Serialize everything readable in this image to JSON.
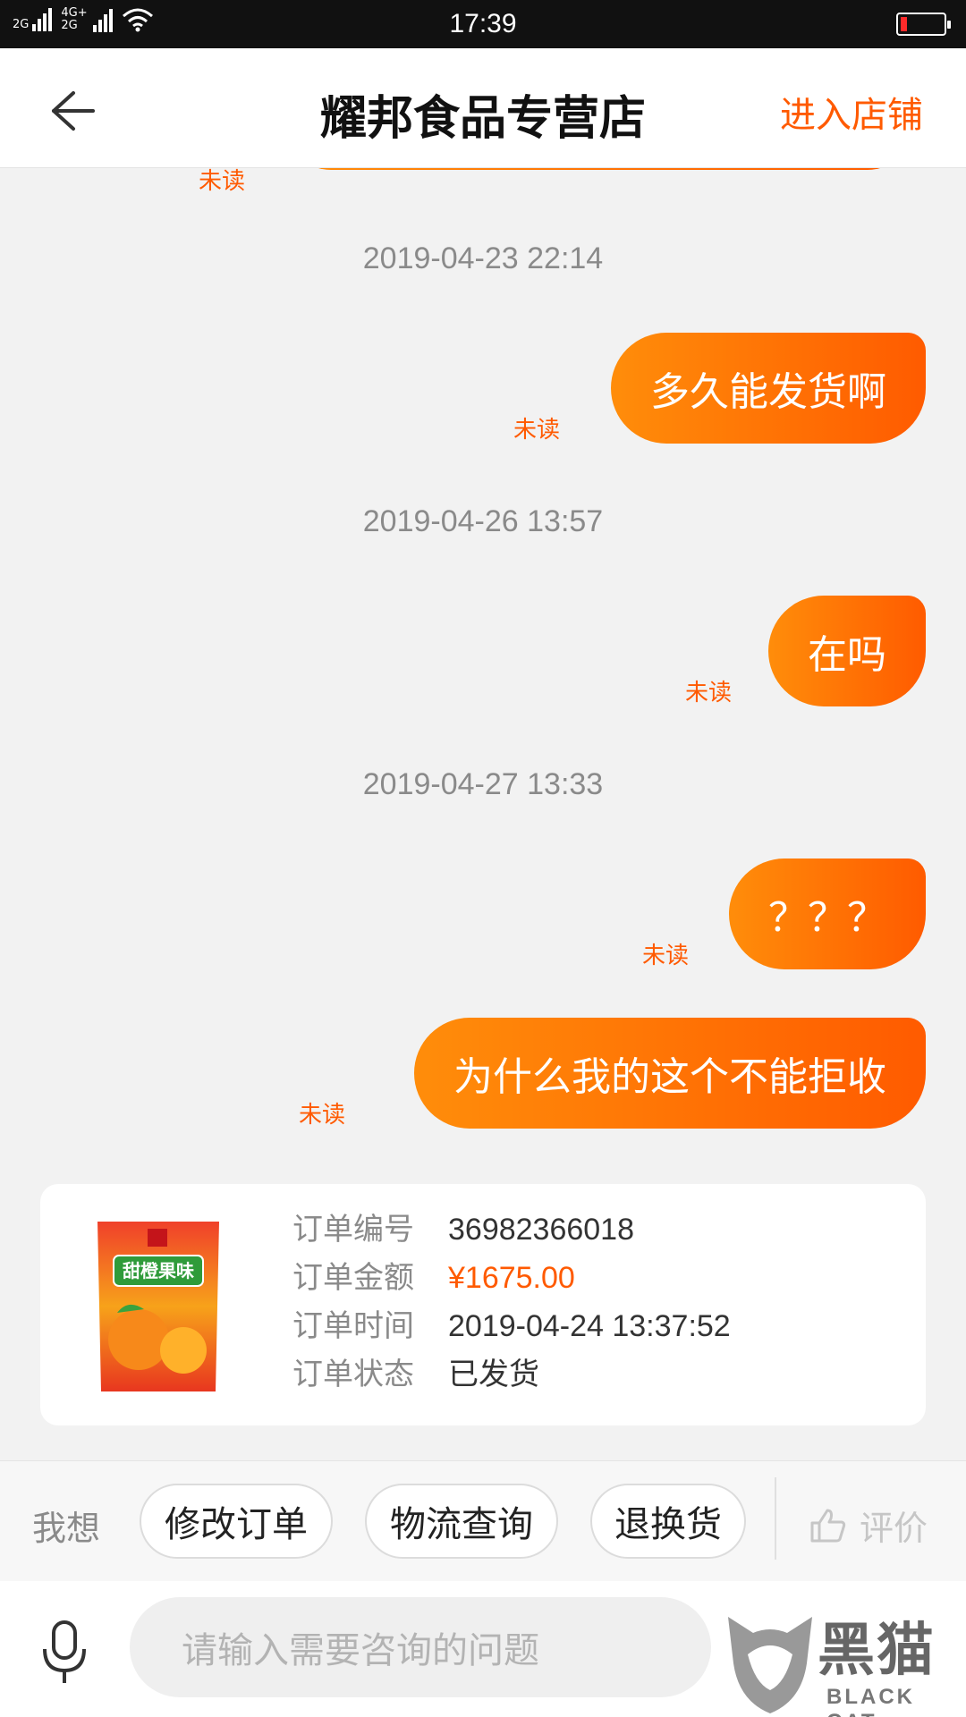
{
  "status_bar": {
    "time": "17:39",
    "sim1": "2G",
    "sim2_top": "4G+",
    "sim2_bottom": "2G"
  },
  "header": {
    "title": "耀邦食品专营店",
    "enter_shop": "进入店铺"
  },
  "chat": {
    "partial_unread": "未读",
    "messages": [
      {
        "timestamp": "2019-04-23 22:14",
        "text": "多久能发货啊",
        "status": "未读"
      },
      {
        "timestamp": "2019-04-26 13:57",
        "text": "在吗",
        "status": "未读"
      },
      {
        "timestamp": "2019-04-27 13:33",
        "text": "？？？",
        "status": "未读"
      },
      {
        "timestamp": "",
        "text": "为什么我的这个不能拒收",
        "status": "未读"
      }
    ]
  },
  "order": {
    "number_label": "订单编号",
    "number": "36982366018",
    "amount_label": "订单金额",
    "amount": "¥1675.00",
    "time_label": "订单时间",
    "time": "2019-04-24 13:37:52",
    "status_label": "订单状态",
    "status": "已发货",
    "product_package_text": "甜橙果味"
  },
  "quick_actions": {
    "prefix": "我想",
    "chips": [
      "修改订单",
      "物流查询",
      "退换货"
    ],
    "rate": "评价"
  },
  "input": {
    "placeholder": "请输入需要咨询的问题"
  },
  "watermark": {
    "text": "黑猫",
    "sub": "BLACK CAT"
  },
  "colors": {
    "accent": "#ff5a00",
    "bubble_start": "#ff8d0a",
    "bubble_end": "#ff5b00"
  }
}
